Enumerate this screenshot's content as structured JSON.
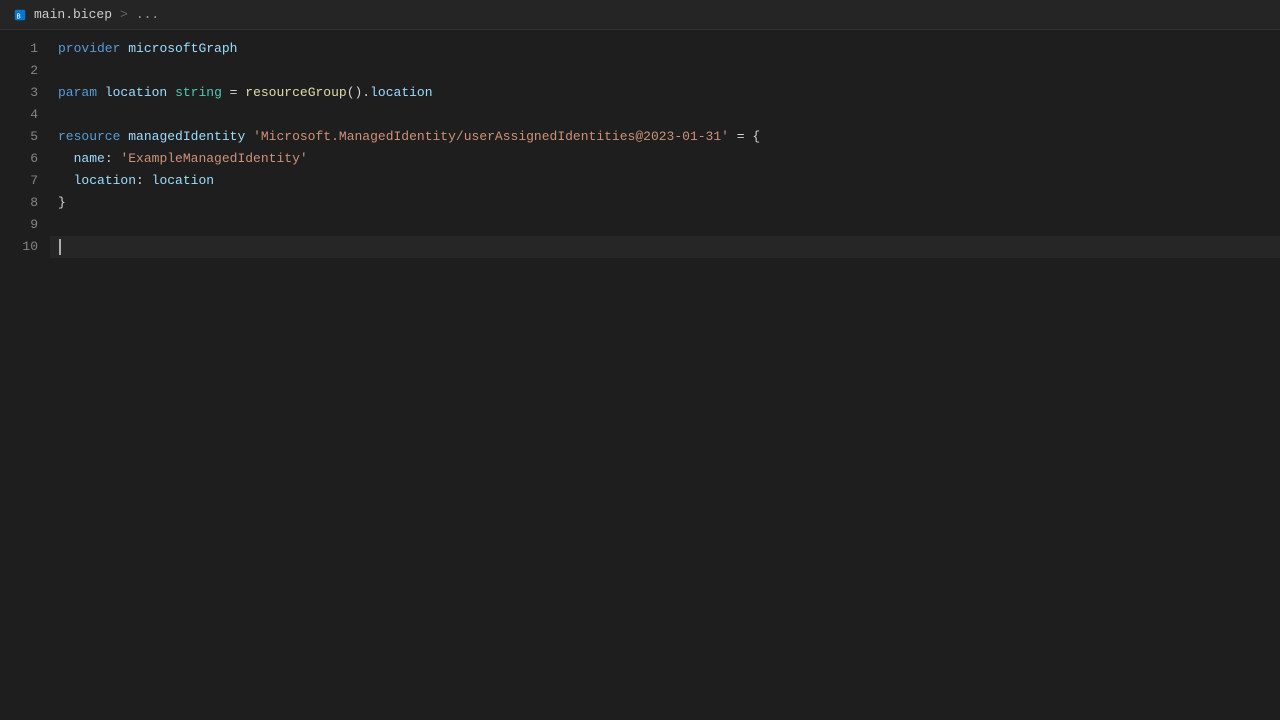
{
  "titlebar": {
    "icon_label": "bicep-file-icon",
    "filename": "main.bicep",
    "separator": ">",
    "breadcrumb": "..."
  },
  "editor": {
    "lines": [
      {
        "number": "1",
        "tokens": [
          {
            "type": "kw-blue",
            "text": "provider"
          },
          {
            "type": "punct",
            "text": " "
          },
          {
            "type": "var-light",
            "text": "microsoftGraph"
          }
        ]
      },
      {
        "number": "2",
        "tokens": []
      },
      {
        "number": "3",
        "tokens": [
          {
            "type": "kw-blue",
            "text": "param"
          },
          {
            "type": "punct",
            "text": " "
          },
          {
            "type": "var-light",
            "text": "location"
          },
          {
            "type": "punct",
            "text": " "
          },
          {
            "type": "kw-teal",
            "text": "string"
          },
          {
            "type": "punct",
            "text": " = "
          },
          {
            "type": "kw-yellow",
            "text": "resourceGroup"
          },
          {
            "type": "punct",
            "text": "()."
          },
          {
            "type": "var-light",
            "text": "location"
          }
        ]
      },
      {
        "number": "4",
        "tokens": []
      },
      {
        "number": "5",
        "tokens": [
          {
            "type": "kw-blue",
            "text": "resource"
          },
          {
            "type": "punct",
            "text": " "
          },
          {
            "type": "var-light",
            "text": "managedIdentity"
          },
          {
            "type": "punct",
            "text": " "
          },
          {
            "type": "str-orange",
            "text": "'Microsoft.ManagedIdentity/userAssignedIdentities@2023-01-31'"
          },
          {
            "type": "punct",
            "text": " = {"
          }
        ]
      },
      {
        "number": "6",
        "tokens": [
          {
            "type": "punct",
            "text": "  "
          },
          {
            "type": "prop-name",
            "text": "name"
          },
          {
            "type": "punct",
            "text": ": "
          },
          {
            "type": "str-orange",
            "text": "'ExampleManagedIdentity'"
          }
        ]
      },
      {
        "number": "7",
        "tokens": [
          {
            "type": "punct",
            "text": "  "
          },
          {
            "type": "prop-name",
            "text": "location"
          },
          {
            "type": "punct",
            "text": ": "
          },
          {
            "type": "var-light",
            "text": "location"
          }
        ]
      },
      {
        "number": "8",
        "tokens": [
          {
            "type": "punct",
            "text": "}"
          }
        ]
      },
      {
        "number": "9",
        "tokens": []
      },
      {
        "number": "10",
        "tokens": [],
        "active": true,
        "cursor": true
      }
    ]
  }
}
